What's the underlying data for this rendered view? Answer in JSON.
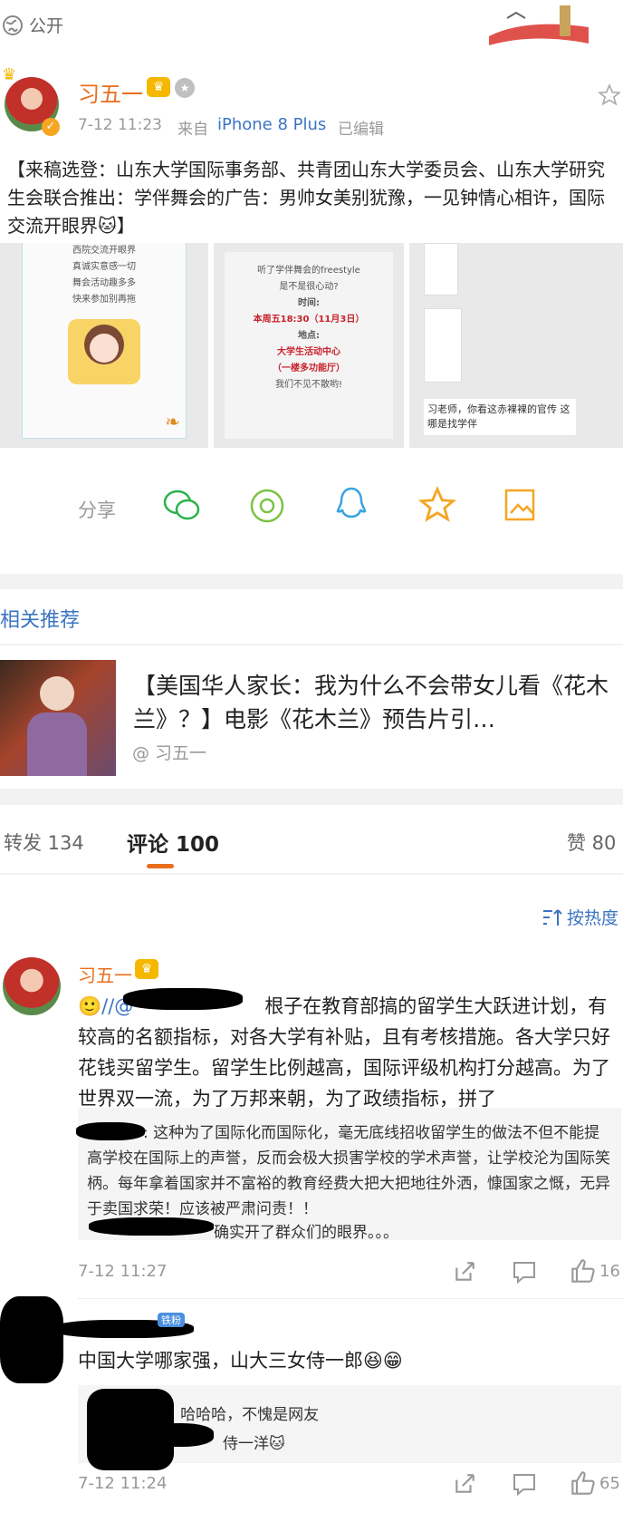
{
  "visibility": "公开",
  "post": {
    "author": "习五一",
    "time": "7-12 11:23",
    "source_prefix": "来自",
    "source_device": "iPhone 8 Plus",
    "edited": "已编辑",
    "content": "【来稿选登：山东大学国际事务部、共青团山东大学委员会、山东大学研究生会联合推出：学伴舞会的广告：男帅女美别犹豫，一见钟情心相许，国际交流开眼界🐱】",
    "image1_lines": [
      "西院交流开眼界",
      "真诚实意感一切",
      "舞会活动趣多多",
      "快来参加别再拖"
    ],
    "image2_lines": [
      "听了学伴舞会的freestyle",
      "是不是很心动?",
      "时间:",
      "本周五18:30（11月3日）",
      "地点:",
      "大学生活动中心",
      "（一楼多功能厅）",
      "我们不见不散哟!"
    ],
    "image3_caption": "习老师，你看这赤裸裸的官传 这哪是找学伴"
  },
  "share": {
    "label": "分享",
    "icons": [
      "wechat-icon",
      "moments-icon",
      "qq-icon",
      "favorite-star-icon",
      "save-image-icon"
    ]
  },
  "related": {
    "heading": "相关推荐",
    "title": "【美国华人家长：我为什么不会带女儿看《花木兰》？】电影《花木兰》预告片引…",
    "author": "@ 习五一"
  },
  "tabs": {
    "repost": "转发 134",
    "comments": "评论 100",
    "likes": "赞 80"
  },
  "sort_label": "按热度",
  "comments": [
    {
      "author": "习五一",
      "text": "🙂//@",
      "text_rest": "根子在教育部搞的留学生大跃进计划，有较高的名额指标，对各大学有补贴，且有考核措施。各大学只好花钱买留学生。留学生比例越高，国际评级机构打分越高。为了世界双一流，为了万邦来朝，为了政绩指标，拼了",
      "reply1": ": 这种为了国际化而国际化，毫无底线招收留学生的做法不但不能提高学校在国际上的声誉，反而会极大损害学校的学术声誉，让学校沦为国际笑柄。每年拿着国家并不富裕的教育经费大把大把地往外洒，慷国家之慨，无异于卖国求荣！应该被严肃问责！！",
      "reply2": "确实开了群众们的眼界。。。",
      "time": "7-12 11:27",
      "likes": "16"
    },
    {
      "badge": "铁粉",
      "text": "中国大学哪家强，山大三女侍一郎😆😁",
      "reply1": ": 哈哈哈，不愧是网友",
      "reply2": "侍一洋🐱",
      "time": "7-12 11:24",
      "likes": "65"
    }
  ],
  "colors": {
    "accent": "#e86e1d",
    "link": "#3b74c2",
    "divider": "#f2f2f2"
  }
}
